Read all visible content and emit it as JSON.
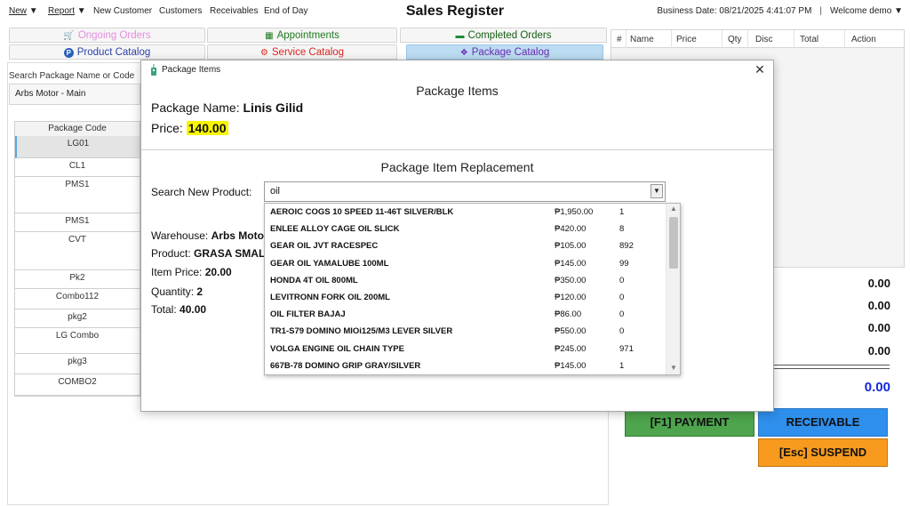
{
  "menu": {
    "new_label": "New",
    "report_label": "Report",
    "new_customer": "New Customer",
    "customers": "Customers",
    "receivables": "Receivables",
    "end_of_day": "End of Day"
  },
  "app_title": "Sales Register",
  "business_date": "Business Date: 08/21/2025 4:41:07 PM",
  "welcome": "Welcome demo",
  "tabs": {
    "ongoing_orders": "Ongoing Orders",
    "appointments": "Appointments",
    "completed_orders": "Completed Orders",
    "product_catalog": "Product Catalog",
    "service_catalog": "Service Catalog",
    "package_catalog": "Package Catalog"
  },
  "left_panel": {
    "search_label": "Search Package Name or Code",
    "warehouse": "Arbs Motor - Main",
    "column_header": "Package Code",
    "rows": [
      "LG01",
      "CL1",
      "PMS1",
      "PMS1",
      "CVT",
      "Pk2",
      "Combo112",
      "pkg2",
      "LG Combo",
      "pkg3",
      "COMBO2"
    ]
  },
  "cart": {
    "columns": [
      "#",
      "Name",
      "Price",
      "Qty",
      "Disc",
      "Total",
      "Action"
    ],
    "amounts": [
      "0.00",
      "0.00",
      "0.00",
      "0.00"
    ],
    "grand_total": "0.00"
  },
  "buttons": {
    "payment": "[F1] PAYMENT",
    "receivable": "RECEIVABLE",
    "suspend": "[Esc] SUSPEND"
  },
  "modal": {
    "window_title": "Package Items",
    "heading": "Package Items",
    "package_name_label": "Package Name:",
    "package_name": "Linis Gilid",
    "price_label": "Price:",
    "price": "140.00",
    "replacement_heading": "Package Item Replacement",
    "search_label": "Search New Product:",
    "search_value": "oil",
    "warehouse_label": "Warehouse:",
    "warehouse_value": "Arbs Moto",
    "product_label": "Product:",
    "product_value": "GRASA SMAL",
    "item_price_label": "Item Price:",
    "item_price": "20.00",
    "quantity_label": "Quantity:",
    "quantity": "2",
    "total_label": "Total:",
    "total": "40.00",
    "results": [
      {
        "name": "AEROIC COGS 10 SPEED 11-46T SILVER/BLK",
        "price": "₱1,950.00",
        "qty": "1"
      },
      {
        "name": "ENLEE ALLOY CAGE OIL SLICK",
        "price": "₱420.00",
        "qty": "8"
      },
      {
        "name": "GEAR OIL JVT RACESPEC",
        "price": "₱105.00",
        "qty": "892"
      },
      {
        "name": "GEAR OIL YAMALUBE 100ML",
        "price": "₱145.00",
        "qty": "99"
      },
      {
        "name": "HONDA 4T OIL 800ML",
        "price": "₱350.00",
        "qty": "0"
      },
      {
        "name": "LEVITRONN FORK OIL 200ML",
        "price": "₱120.00",
        "qty": "0"
      },
      {
        "name": "OIL FILTER BAJAJ",
        "price": "₱86.00",
        "qty": "0"
      },
      {
        "name": "TR1-S79 DOMINO MIOi125/M3 LEVER SILVER",
        "price": "₱550.00",
        "qty": "0"
      },
      {
        "name": "VOLGA ENGINE OIL CHAIN TYPE",
        "price": "₱245.00",
        "qty": "971"
      },
      {
        "name": "667B-78 DOMINO GRIP GRAY/SILVER",
        "price": "₱145.00",
        "qty": "1"
      }
    ]
  },
  "colors": {
    "accent_blue": "#2f8fec",
    "payment_green": "#4ea54d",
    "suspend_orange": "#f79a1e",
    "price_highlight": "#f8f600",
    "total_blue": "#1428d8"
  }
}
